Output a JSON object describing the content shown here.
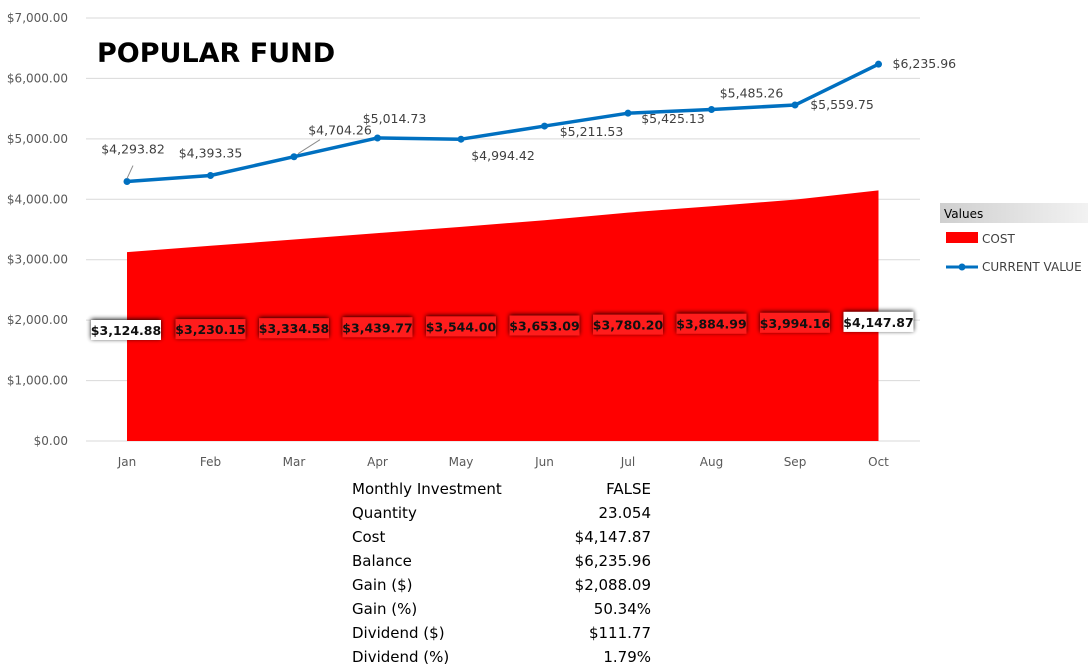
{
  "chart_data": {
    "type": "area+line",
    "title": "POPULAR FUND",
    "categories": [
      "Jan",
      "Feb",
      "Mar",
      "Apr",
      "May",
      "Jun",
      "Jul",
      "Aug",
      "Sep",
      "Oct"
    ],
    "ylim": [
      0,
      7000
    ],
    "yticks": [
      0,
      1000,
      2000,
      3000,
      4000,
      5000,
      6000,
      7000
    ],
    "ytick_labels": [
      "$0.00",
      "$1,000.00",
      "$2,000.00",
      "$3,000.00",
      "$4,000.00",
      "$5,000.00",
      "$6,000.00",
      "$7,000.00"
    ],
    "grid": true,
    "legend": {
      "title": "Values",
      "position": "right"
    },
    "series": [
      {
        "name": "COST",
        "kind": "area",
        "color": "#ff0000",
        "values": [
          3124.88,
          3230.15,
          3334.58,
          3439.77,
          3544.0,
          3653.09,
          3780.2,
          3884.99,
          3994.16,
          4147.87
        ],
        "labels": [
          "$3,124.88",
          "$3,230.15",
          "$3,334.58",
          "$3,439.77",
          "$3,544.00",
          "$3,653.09",
          "$3,780.20",
          "$3,884.99",
          "$3,994.16",
          "$4,147.87"
        ]
      },
      {
        "name": "CURRENT VALUE",
        "kind": "line",
        "color": "#0070c0",
        "values": [
          4293.82,
          4393.35,
          4704.26,
          5014.73,
          4994.42,
          5211.53,
          5425.13,
          5485.26,
          5559.75,
          6235.96
        ],
        "labels": [
          "$4,293.82",
          "$4,393.35",
          "$4,704.26",
          "$5,014.73",
          "$4,994.42",
          "$5,211.53",
          "$5,425.13",
          "$5,485.26",
          "$5,559.75",
          "$6,235.96"
        ]
      }
    ]
  },
  "summary": [
    {
      "label": "Monthly Investment",
      "value": "FALSE"
    },
    {
      "label": "Quantity",
      "value": "23.054"
    },
    {
      "label": "Cost",
      "value": "$4,147.87"
    },
    {
      "label": "Balance",
      "value": "$6,235.96"
    },
    {
      "label": "Gain ($)",
      "value": "$2,088.09"
    },
    {
      "label": "Gain (%)",
      "value": "50.34%"
    },
    {
      "label": "Dividend ($)",
      "value": "$111.77"
    },
    {
      "label": "Dividend (%)",
      "value": "1.79%"
    }
  ]
}
